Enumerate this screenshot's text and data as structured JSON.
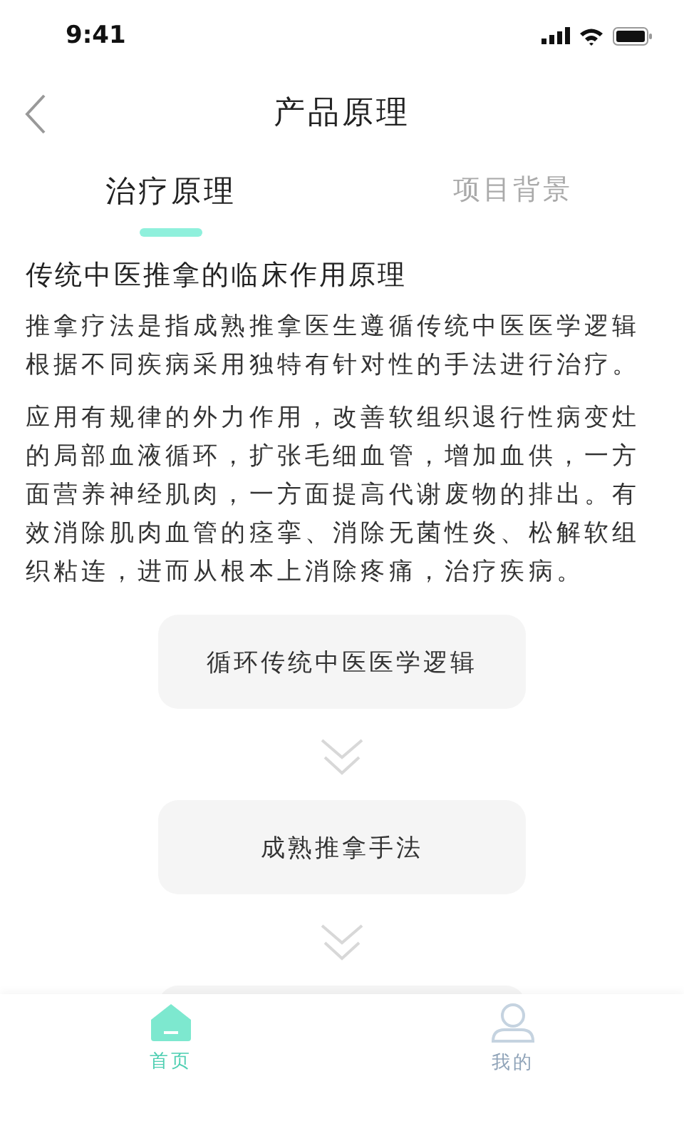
{
  "status_bar": {
    "time": "9:41"
  },
  "nav": {
    "title": "产品原理"
  },
  "tabs": [
    {
      "label": "治疗原理",
      "selected": true
    },
    {
      "label": "项目背景",
      "selected": false
    }
  ],
  "heading": "传统中医推拿的临床作用原理",
  "paragraphs": [
    "推拿疗法是指成熟推拿医生遵循传统中医医学逻辑根据不同疾病采用独特有针对性的手法进行治疗。",
    "应用有规律的外力作用，改善软组织退行性病变灶的局部血液循环，扩张毛细血管，增加血供，一方面营养神经肌肉，一方面提高代谢废物的排出。有效消除肌肉血管的痉挛、消除无菌性炎、松解软组织粘连，进而从根本上消除疼痛，治疗疾病。"
  ],
  "flow_steps": [
    "循环传统中医医学逻辑",
    "成熟推拿手法"
  ],
  "tab_bar": [
    {
      "label": "首页",
      "kind": "home",
      "selected": true
    },
    {
      "label": "我的",
      "kind": "profile",
      "selected": false
    }
  ]
}
